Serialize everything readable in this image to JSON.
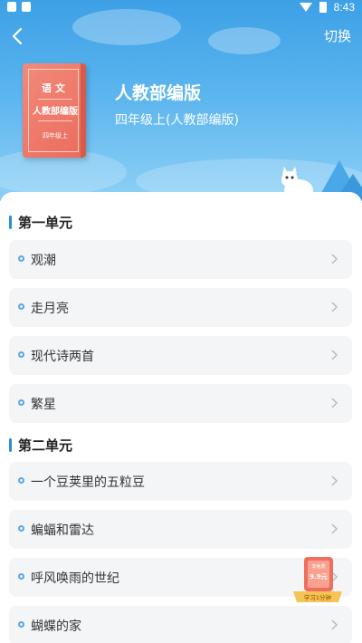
{
  "status_bar": {
    "time": "8:43"
  },
  "header": {
    "switch_label": "切换",
    "title": "人教部编版",
    "subtitle": "四年级上(人教部编版)",
    "book": {
      "line1": "语文",
      "line2": "人教部编版",
      "line3": "四年级上"
    }
  },
  "sections": [
    {
      "title": "第一单元",
      "items": [
        "观潮",
        "走月亮",
        "现代诗两首",
        "繁星"
      ]
    },
    {
      "title": "第二单元",
      "items": [
        "一个豆荚里的五粒豆",
        "蝙蝠和雷达",
        "呼风唤雨的世纪",
        "蝴蝶的家"
      ]
    }
  ],
  "promo": {
    "top_text": "享免费",
    "price": "9.9元",
    "bottom_text": "学习1分钟"
  },
  "colors": {
    "accent": "#2b8fd8",
    "header_top": "#3da0e6",
    "book": "#ea6c5d"
  }
}
